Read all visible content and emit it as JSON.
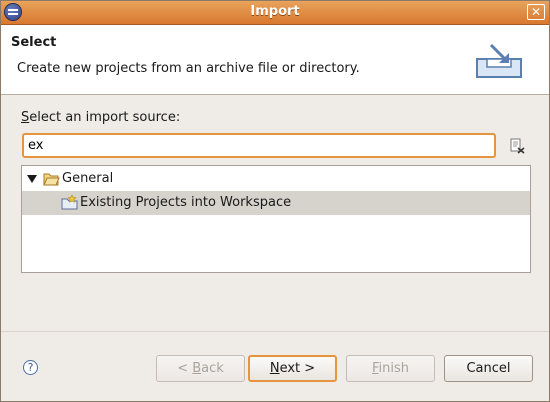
{
  "window": {
    "title": "Import"
  },
  "header": {
    "title": "Select",
    "description": "Create new projects from an archive file or directory."
  },
  "source": {
    "label_mnemonic": "S",
    "label_rest": "elect an import source:",
    "filter_value": "ex"
  },
  "tree": {
    "items": [
      {
        "label": "General",
        "expanded": true,
        "icon": "folder-open-icon"
      },
      {
        "label": "Existing Projects into Workspace",
        "selected": true,
        "icon": "project-icon"
      }
    ]
  },
  "buttons": {
    "back": "< Back",
    "next": "Next >",
    "finish": "Finish",
    "cancel": "Cancel"
  },
  "colors": {
    "titlebar": "#d9782f",
    "focus": "#e5953e",
    "selection": "#d6d2cc"
  }
}
